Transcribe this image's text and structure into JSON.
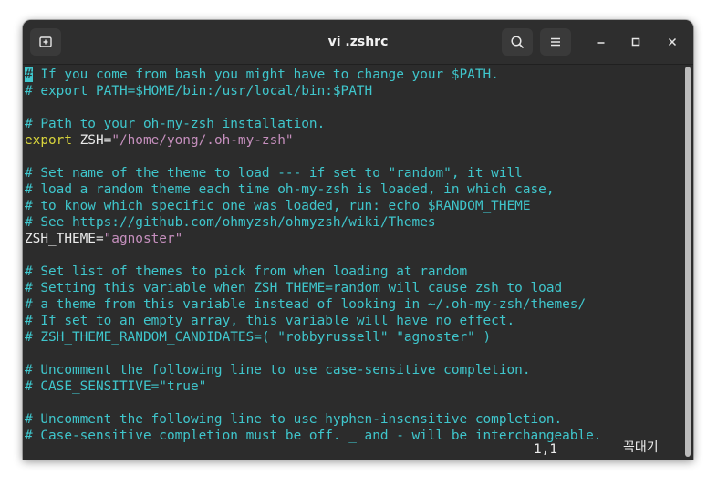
{
  "window": {
    "title": "vi .zshrc"
  },
  "icons": {
    "new_tab": "new-tab-icon",
    "search": "search-icon",
    "menu": "hamburger-menu-icon",
    "minimize": "minimize-icon",
    "maximize": "maximize-icon",
    "close": "close-icon"
  },
  "colors": {
    "comment": "#3fc6cc",
    "keyword": "#d8d43c",
    "string": "#c58fbd",
    "text": "#ececec",
    "background": "#2c2c2c"
  },
  "editor": {
    "lines": [
      [
        {
          "t": "cursor",
          "v": "#"
        },
        {
          "t": "cmt",
          "v": " If you come from bash you might have to change your $PATH."
        }
      ],
      [
        {
          "t": "cmt",
          "v": "# export PATH=$HOME/bin:/usr/local/bin:$PATH"
        }
      ],
      [],
      [
        {
          "t": "cmt",
          "v": "# Path to your oh-my-zsh installation."
        }
      ],
      [
        {
          "t": "kw",
          "v": "export"
        },
        {
          "t": "plain",
          "v": " ZSH="
        },
        {
          "t": "str",
          "v": "\"/home/yong/.oh-my-zsh\""
        }
      ],
      [],
      [
        {
          "t": "cmt",
          "v": "# Set name of the theme to load --- if set to \"random\", it will"
        }
      ],
      [
        {
          "t": "cmt",
          "v": "# load a random theme each time oh-my-zsh is loaded, in which case,"
        }
      ],
      [
        {
          "t": "cmt",
          "v": "# to know which specific one was loaded, run: echo $RANDOM_THEME"
        }
      ],
      [
        {
          "t": "cmt",
          "v": "# See https://github.com/ohmyzsh/ohmyzsh/wiki/Themes"
        }
      ],
      [
        {
          "t": "plain",
          "v": "ZSH_THEME="
        },
        {
          "t": "str",
          "v": "\"agnoster\""
        }
      ],
      [],
      [
        {
          "t": "cmt",
          "v": "# Set list of themes to pick from when loading at random"
        }
      ],
      [
        {
          "t": "cmt",
          "v": "# Setting this variable when ZSH_THEME=random will cause zsh to load"
        }
      ],
      [
        {
          "t": "cmt",
          "v": "# a theme from this variable instead of looking in ~/.oh-my-zsh/themes/"
        }
      ],
      [
        {
          "t": "cmt",
          "v": "# If set to an empty array, this variable will have no effect."
        }
      ],
      [
        {
          "t": "cmt",
          "v": "# ZSH_THEME_RANDOM_CANDIDATES=( \"robbyrussell\" \"agnoster\" )"
        }
      ],
      [],
      [
        {
          "t": "cmt",
          "v": "# Uncomment the following line to use case-sensitive completion."
        }
      ],
      [
        {
          "t": "cmt",
          "v": "# CASE_SENSITIVE=\"true\""
        }
      ],
      [],
      [
        {
          "t": "cmt",
          "v": "# Uncomment the following line to use hyphen-insensitive completion."
        }
      ],
      [
        {
          "t": "cmt",
          "v": "# Case-sensitive completion must be off. _ and - will be interchangeable."
        }
      ]
    ]
  },
  "status": {
    "cursor_position": "1,1",
    "input_method": "꼭대기"
  }
}
